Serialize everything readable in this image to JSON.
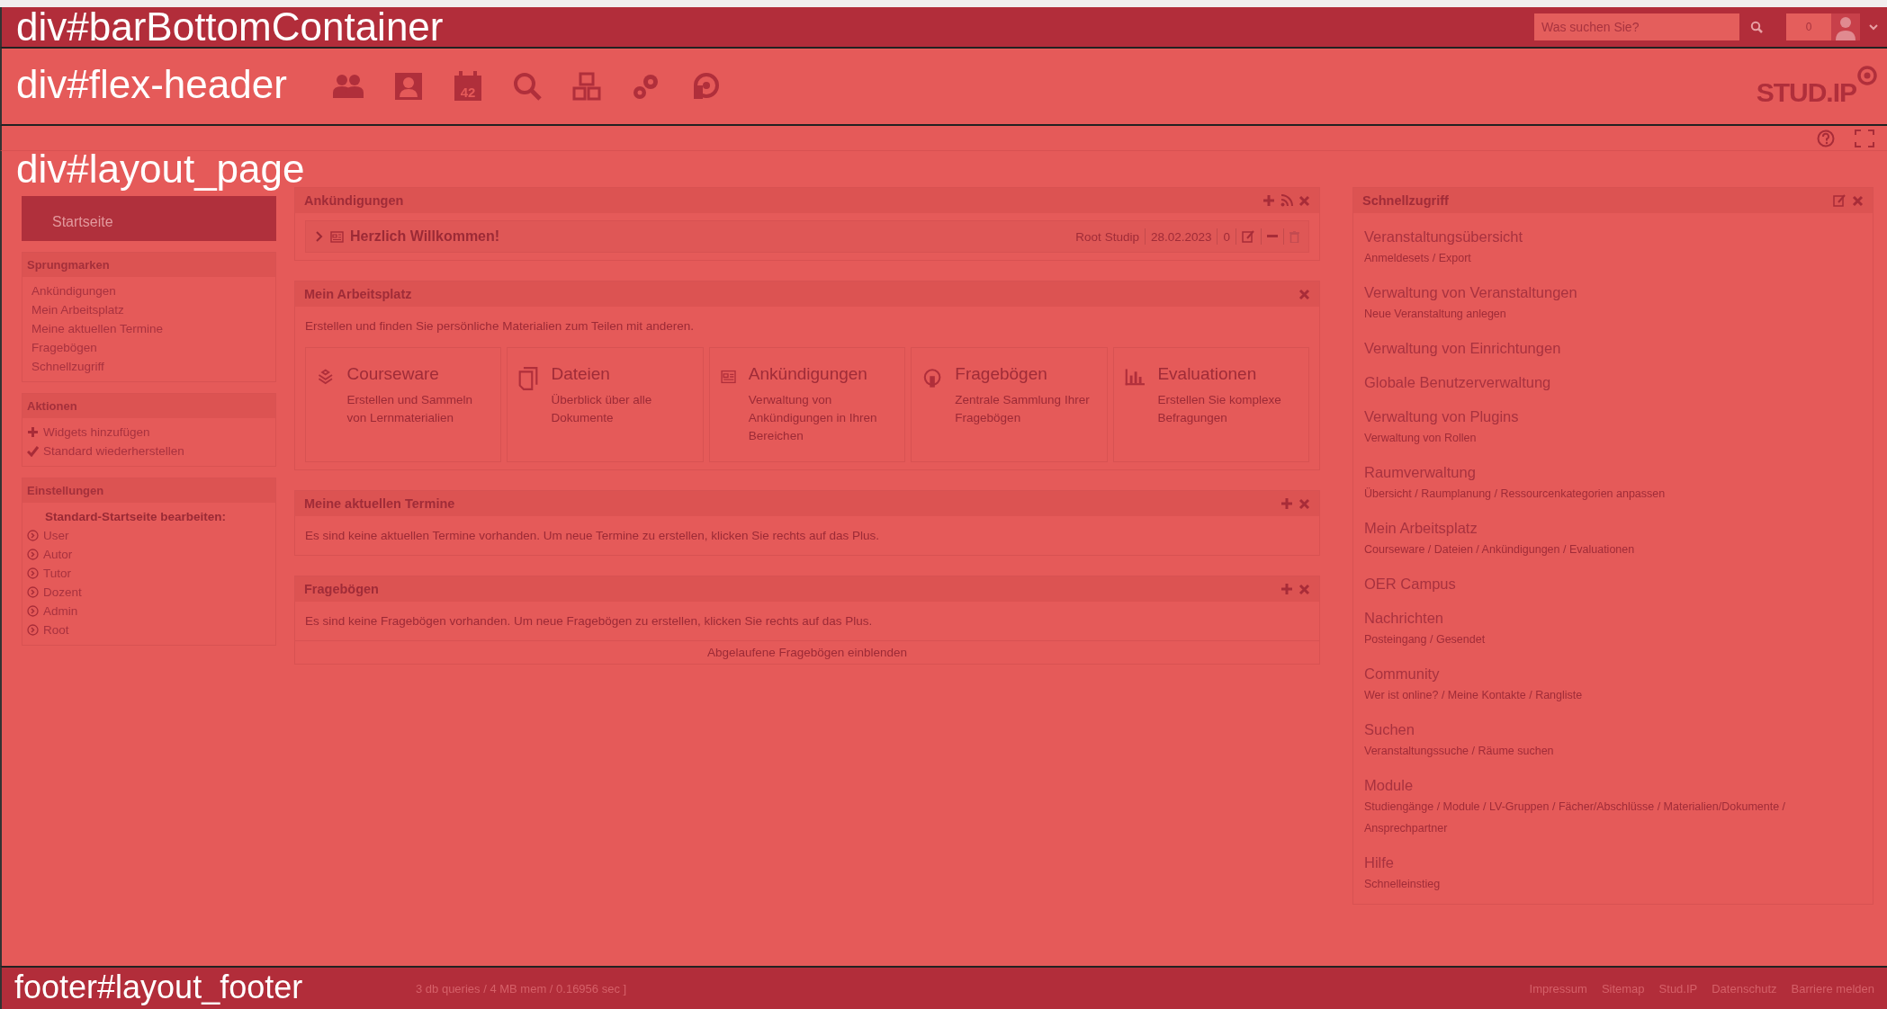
{
  "top_bar": {
    "region_label": "div#barBottomContainer",
    "search": {
      "placeholder": "Was suchen Sie?"
    },
    "notification_count": "0"
  },
  "header": {
    "region_label": "div#flex-header",
    "nav": [
      {
        "kind": "people"
      },
      {
        "kind": "profile"
      },
      {
        "kind": "calendar",
        "day": "42"
      },
      {
        "kind": "search"
      },
      {
        "kind": "tools"
      },
      {
        "kind": "gears"
      },
      {
        "kind": "circle"
      }
    ],
    "logo": "STUD.IP"
  },
  "page": {
    "region_label": "div#layout_page"
  },
  "sidebar": {
    "title": "Startseite",
    "sections": [
      {
        "title": "Sprungmarken",
        "items": [
          {
            "kind": "link",
            "label": "Ankündigungen"
          },
          {
            "kind": "link",
            "label": "Mein Arbeitsplatz"
          },
          {
            "kind": "link",
            "label": "Meine aktuellen Termine"
          },
          {
            "kind": "link",
            "label": "Fragebögen"
          },
          {
            "kind": "link",
            "label": "Schnellzugriff"
          }
        ]
      },
      {
        "title": "Aktionen",
        "items": [
          {
            "kind": "plus",
            "label": "Widgets hinzufügen"
          },
          {
            "kind": "check",
            "label": "Standard wiederherstellen"
          }
        ]
      },
      {
        "title": "Einstellungen",
        "items": [
          {
            "kind": "heading",
            "label": "Standard-Startseite bearbeiten:"
          },
          {
            "kind": "arrow",
            "label": "User"
          },
          {
            "kind": "arrow",
            "label": "Autor"
          },
          {
            "kind": "arrow",
            "label": "Tutor"
          },
          {
            "kind": "arrow",
            "label": "Dozent"
          },
          {
            "kind": "arrow",
            "label": "Admin"
          },
          {
            "kind": "arrow",
            "label": "Root"
          }
        ]
      }
    ]
  },
  "widgets": [
    {
      "kind": "news",
      "title": "Ankündigungen",
      "actions": [
        {
          "kind": "plus"
        },
        {
          "kind": "rss"
        },
        {
          "kind": "close"
        }
      ],
      "entries": [
        {
          "title": "Herzlich Willkommen!",
          "author": "Root Studip",
          "date": "28.02.2023",
          "count": "0",
          "expanded": false
        }
      ]
    },
    {
      "kind": "tiles",
      "title": "Mein Arbeitsplatz",
      "actions": [
        {
          "kind": "close"
        }
      ],
      "intro": "Erstellen und finden Sie persönliche Materialien zum Teilen mit anderen.",
      "tiles": [
        {
          "kind": "courseware",
          "title": "Courseware",
          "description": "Erstellen und Sammeln von Lernmaterialien"
        },
        {
          "kind": "files",
          "title": "Dateien",
          "description": "Überblick über alle Dokumente"
        },
        {
          "kind": "news",
          "title": "Ankündigungen",
          "description": "Verwaltung von Ankündigungen in Ihren Bereichen"
        },
        {
          "kind": "questionnaire",
          "title": "Fragebögen",
          "description": "Zentrale Sammlung Ihrer Fragebögen"
        },
        {
          "kind": "evaluation",
          "title": "Evaluationen",
          "description": "Erstellen Sie komplexe Befragungen"
        }
      ]
    },
    {
      "kind": "text",
      "title": "Meine aktuellen Termine",
      "actions": [
        {
          "kind": "plus"
        },
        {
          "kind": "close"
        }
      ],
      "text": "Es sind keine aktuellen Termine vorhanden. Um neue Termine zu erstellen, klicken Sie rechts auf das Plus."
    },
    {
      "kind": "text",
      "title": "Fragebögen",
      "actions": [
        {
          "kind": "plus"
        },
        {
          "kind": "close"
        }
      ],
      "text": "Es sind keine Fragebögen vorhanden. Um neue Fragebögen zu erstellen, klicken Sie rechts auf das Plus.",
      "footer_link": "Abgelaufene Fragebögen einblenden"
    }
  ],
  "quick_access": {
    "title": "Schnellzugriff",
    "actions": [
      {
        "kind": "edit"
      },
      {
        "kind": "close"
      }
    ],
    "items": [
      {
        "title": "Veranstaltungsübersicht",
        "subtitle": "Anmeldesets / Export"
      },
      {
        "title": "Verwaltung von Veranstaltungen",
        "subtitle": "Neue Veranstaltung anlegen"
      },
      {
        "title": "Verwaltung von Einrichtungen"
      },
      {
        "title": "Globale Benutzerverwaltung"
      },
      {
        "title": "Verwaltung von Plugins",
        "subtitle": "Verwaltung von Rollen"
      },
      {
        "title": "Raumverwaltung",
        "subtitle": "Übersicht / Raumplanung / Ressourcenkategorien anpassen"
      },
      {
        "title": "Mein Arbeitsplatz",
        "subtitle": "Courseware / Dateien / Ankündigungen / Evaluationen"
      },
      {
        "title": "OER Campus"
      },
      {
        "title": "Nachrichten",
        "subtitle": "Posteingang / Gesendet"
      },
      {
        "title": "Community",
        "subtitle": "Wer ist online? / Meine Kontakte / Rangliste"
      },
      {
        "title": "Suchen",
        "subtitle": "Veranstaltungssuche / Räume suchen"
      },
      {
        "title": "Module",
        "subtitle": "Studiengänge / Module / LV-Gruppen / Fächer/Abschlüsse / Materialien/Dokumente / Ansprechpartner"
      },
      {
        "title": "Hilfe",
        "subtitle": "Schnelleinstieg"
      }
    ]
  },
  "footer": {
    "region_label": "footer#layout_footer",
    "stats": "3 db queries / 4 MB mem / 0.16956 sec ]",
    "links": [
      "Impressum",
      "Sitemap",
      "Stud.IP",
      "Datenschutz",
      "Barriere melden"
    ]
  }
}
